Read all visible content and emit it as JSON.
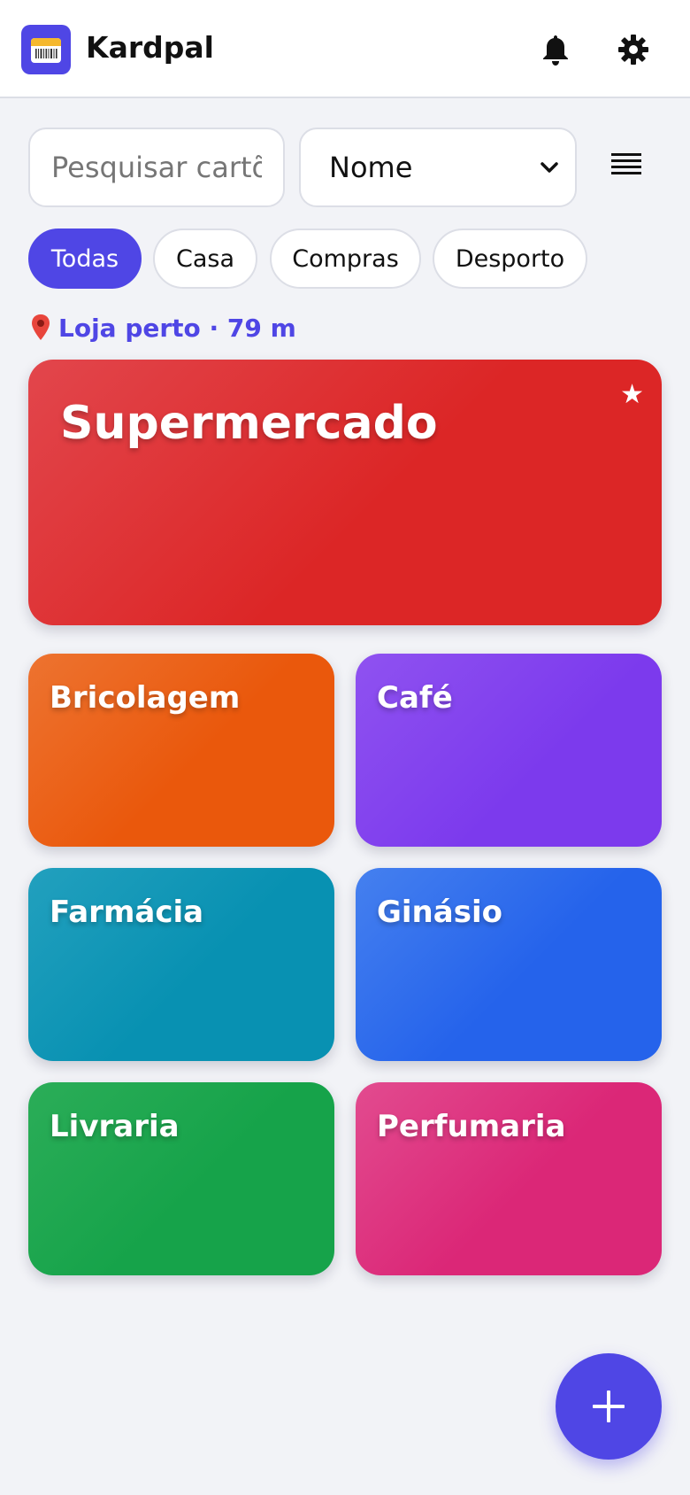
{
  "header": {
    "app_name": "Kardpal"
  },
  "toolbar": {
    "search_placeholder": "Pesquisar cartões",
    "sort_value": "Nome",
    "sort_options": [
      "Nome"
    ]
  },
  "filters": [
    "Todas",
    "Casa",
    "Compras",
    "Desporto"
  ],
  "nearby": {
    "label": "Loja perto · 79 m"
  },
  "featured_card": {
    "name": "Supermercado",
    "favorite": "★",
    "color": "#dc2626"
  },
  "cards": [
    {
      "name": "Bricolagem",
      "color": "#ea580c"
    },
    {
      "name": "Café",
      "color": "#7c3aed"
    },
    {
      "name": "Farmácia",
      "color": "#0891b2"
    },
    {
      "name": "Ginásio",
      "color": "#2563eb"
    },
    {
      "name": "Livraria",
      "color": "#16a34a"
    },
    {
      "name": "Perfumaria",
      "color": "#db2777"
    }
  ],
  "colors": {
    "accent": "#4f46e5",
    "background": "#f2f3f7"
  },
  "icons": {
    "logo": "barcode-card-icon",
    "notifications": "bell-icon",
    "settings": "gear-icon",
    "view": "list-view-icon",
    "location": "map-pin-icon",
    "add": "plus-icon"
  }
}
